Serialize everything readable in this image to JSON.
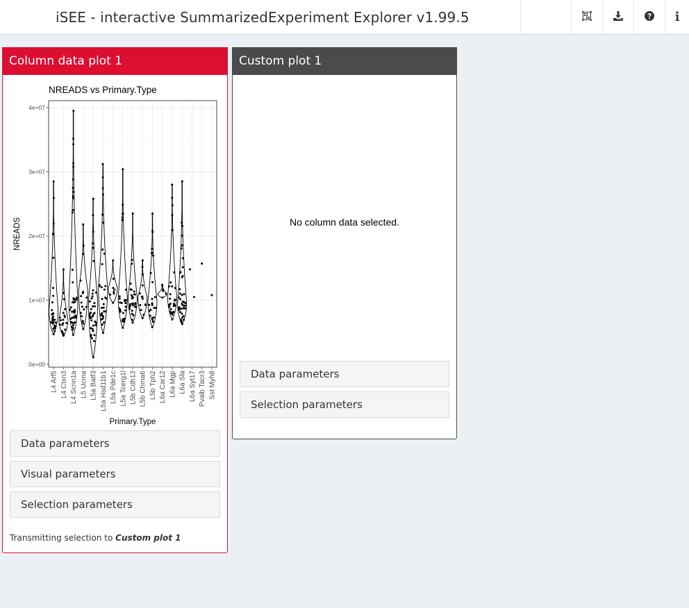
{
  "header": {
    "title": "iSEE - interactive SummarizedExperiment Explorer v1.99.5",
    "buttons": [
      {
        "icon": "object-group-icon"
      },
      {
        "icon": "download-icon"
      },
      {
        "icon": "question-circle-icon"
      },
      {
        "icon": "info-icon"
      }
    ]
  },
  "left_panel": {
    "title": "Column data plot 1",
    "header_color": "#dc0f31",
    "sections": {
      "data": "Data parameters",
      "visual": "Visual parameters",
      "selection": "Selection parameters"
    },
    "transmit_prefix": "Transmitting selection to ",
    "transmit_target": "Custom plot 1"
  },
  "right_panel": {
    "title": "Custom plot 1",
    "header_color": "#4b4b4b",
    "message": "No column data selected.",
    "sections": {
      "data": "Data parameters",
      "selection": "Selection parameters"
    }
  },
  "chart_data": {
    "type": "violin",
    "title": "NREADS vs Primary.Type",
    "xlabel": "Primary.Type",
    "ylabel": "NREADS",
    "ylim": [
      0,
      41000000
    ],
    "yticks": [
      0,
      10000000,
      20000000,
      30000000,
      40000000
    ],
    "ytick_labels": [
      "0e+00",
      "1e+07",
      "2e+07",
      "3e+07",
      "4e+07"
    ],
    "categories": [
      "L4 Arf5",
      "L4 Ctxn3",
      "L4 Scnn1a",
      "L5 Ucma",
      "L5a Batf3",
      "L5a Hsd11b1",
      "L5a Pde1c",
      "L5a Tcerg1l",
      "L5b Cdh13",
      "L5b Chrna6",
      "L5b Tph2",
      "L6a Car12",
      "L6a Mgp",
      "L6a Sla",
      "L6a Syt17",
      "Pvalb Tacr3",
      "Sst Myh8"
    ],
    "groups": [
      {
        "min": 4700000,
        "max": 28500000,
        "median": 8500000,
        "n": 30
      },
      {
        "min": 4500000,
        "max": 14800000,
        "median": 7000000,
        "n": 22
      },
      {
        "min": 4600000,
        "max": 39500000,
        "median": 10000000,
        "n": 48
      },
      {
        "min": 5500000,
        "max": 21800000,
        "median": 11500000,
        "n": 18
      },
      {
        "min": 1100000,
        "max": 25800000,
        "median": 10000000,
        "n": 40
      },
      {
        "min": 4900000,
        "max": 31200000,
        "median": 12000000,
        "n": 34
      },
      {
        "min": 9600000,
        "max": 16200000,
        "median": 12000000,
        "n": 8
      },
      {
        "min": 5700000,
        "max": 30400000,
        "median": 10500000,
        "n": 30
      },
      {
        "min": 6500000,
        "max": 23500000,
        "median": 10500000,
        "n": 30
      },
      {
        "min": 7200000,
        "max": 16200000,
        "median": 10500000,
        "n": 14
      },
      {
        "min": 5800000,
        "max": 23500000,
        "median": 10000000,
        "n": 24
      },
      {
        "min": 10400000,
        "max": 12400000,
        "median": 11000000,
        "n": 6
      },
      {
        "min": 7000000,
        "max": 28000000,
        "median": 10500000,
        "n": 30
      },
      {
        "min": 6300000,
        "max": 28500000,
        "median": 9500000,
        "n": 46
      },
      {
        "min": 10500000,
        "max": 14800000,
        "median": 12600000,
        "n": 2
      },
      {
        "min": 15700000,
        "max": 15700000,
        "median": 15700000,
        "n": 1
      },
      {
        "min": 10800000,
        "max": 10800000,
        "median": 10800000,
        "n": 1
      }
    ]
  }
}
